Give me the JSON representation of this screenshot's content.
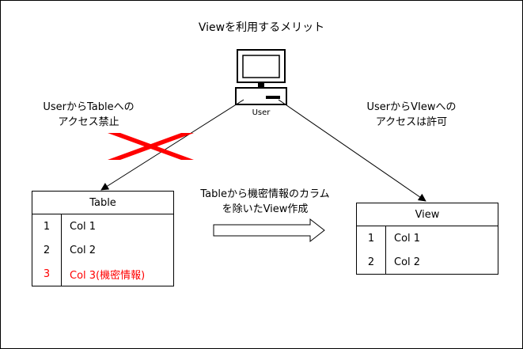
{
  "title": "Viewを利用するメリット",
  "user": {
    "label": "User",
    "icon": "computer-user-icon"
  },
  "left_note": {
    "line1": "UserからTableへの",
    "line2": "アクセス禁止"
  },
  "right_note": {
    "line1": "UserからVIewへの",
    "line2": "アクセスは許可"
  },
  "middle_note": {
    "line1": "Tableから機密情報のカラム",
    "line2": "を除いたView作成"
  },
  "table": {
    "header": "Table",
    "rows": [
      {
        "num": "1",
        "col": "Col 1"
      },
      {
        "num": "2",
        "col": "Col 2"
      },
      {
        "num": "3",
        "col": "Col 3(機密情報)"
      }
    ]
  },
  "view": {
    "header": "View",
    "rows": [
      {
        "num": "1",
        "col": "Col 1"
      },
      {
        "num": "2",
        "col": "Col 2"
      }
    ]
  },
  "colors": {
    "forbidden": "#ff0000",
    "line": "#000000",
    "background": "#ffffff",
    "sensitive_text": "#ff0000"
  },
  "icons": [
    "computer-user-icon",
    "forbidden-cross-icon",
    "block-arrow-icon"
  ]
}
